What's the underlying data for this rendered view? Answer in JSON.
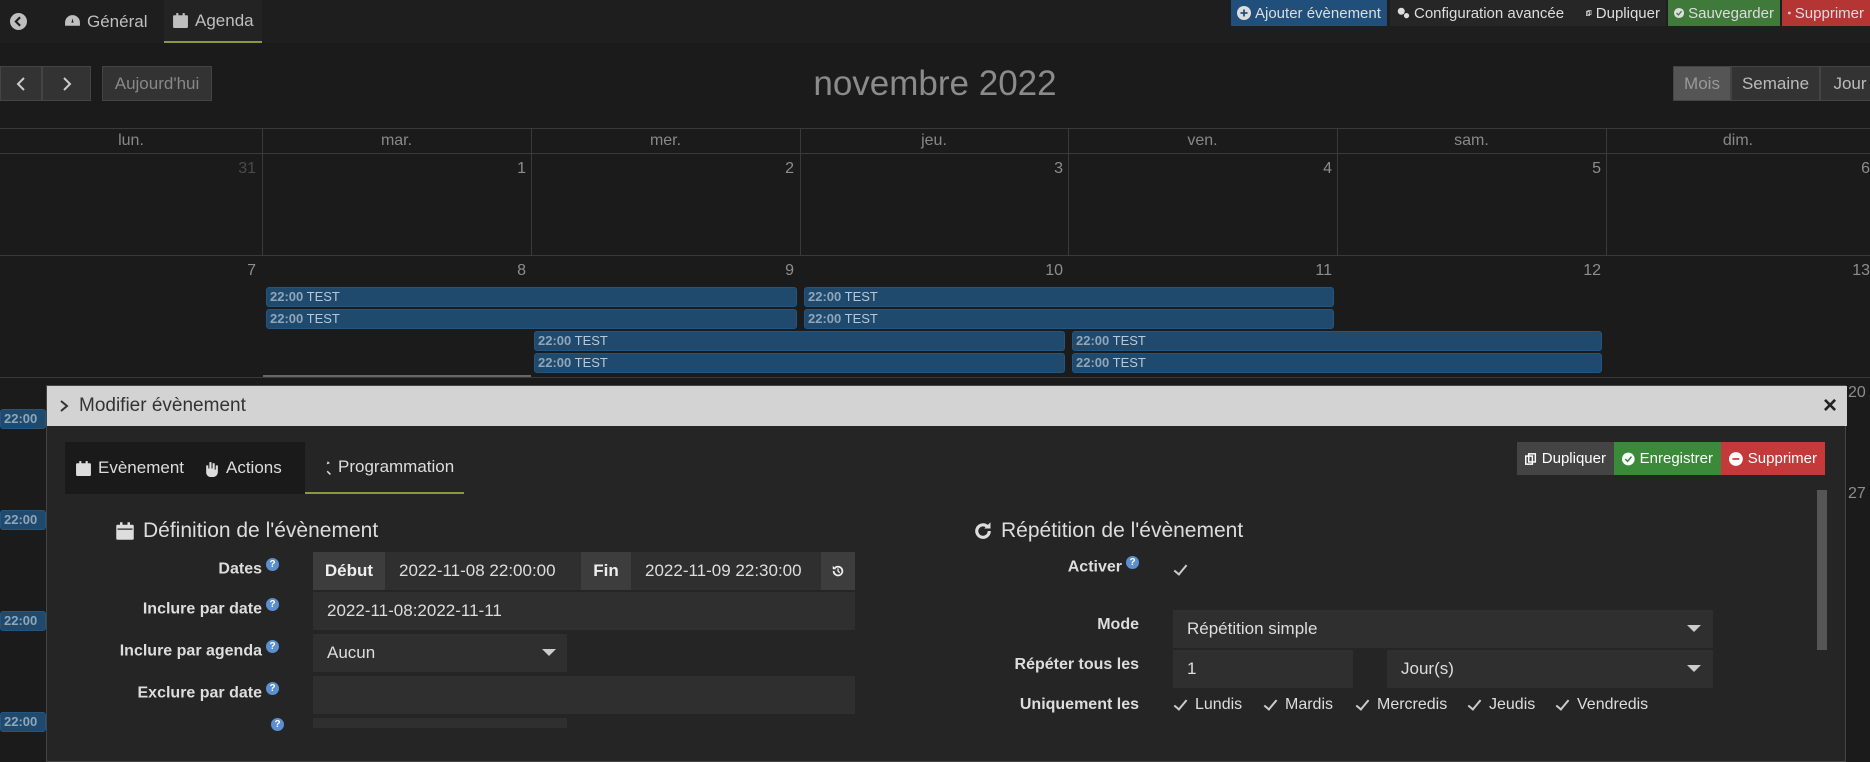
{
  "topbar": {
    "back_icon": "arrow-left-circle-icon",
    "tabs": [
      {
        "label": "Général",
        "icon": "gauge-icon"
      },
      {
        "label": "Agenda",
        "icon": "calendar-icon"
      }
    ],
    "actions": [
      {
        "label": "Ajouter évènement",
        "icon": "plus-circle-icon",
        "color": "#1f4f7a"
      },
      {
        "label": "Configuration avancée",
        "icon": "cogs-icon",
        "color": "#262626"
      },
      {
        "label": "Dupliquer",
        "icon": "copy-icon",
        "color": "#262626"
      },
      {
        "label": "Sauvegarder",
        "icon": "check-circle-icon",
        "color": "#3f7a3a"
      },
      {
        "label": "Supprimer",
        "icon": "minus-circle-icon",
        "color": "#b53434"
      }
    ]
  },
  "calendar": {
    "title": "novembre 2022",
    "today_label": "Aujourd'hui",
    "prev_icon": "chevron-left-icon",
    "next_icon": "chevron-right-icon",
    "views": [
      "Mois",
      "Semaine",
      "Jour"
    ],
    "active_view": "Mois",
    "weekdays": [
      "lun.",
      "mar.",
      "mer.",
      "jeu.",
      "ven.",
      "sam.",
      "dim."
    ],
    "week1": [
      "31",
      "1",
      "2",
      "3",
      "4",
      "5",
      "6"
    ],
    "week2": [
      "7",
      "8",
      "9",
      "10",
      "11",
      "12",
      "13"
    ],
    "week3_partial": [
      "20",
      "27"
    ],
    "event_time": "22:00",
    "event_title": "TEST"
  },
  "modal": {
    "title": "Modifier évènement",
    "tabs": [
      {
        "label": "Evènement",
        "icon": "calendar-icon"
      },
      {
        "label": "Actions",
        "icon": "hand-icon"
      },
      {
        "label": "Programmation",
        "icon": "tools-icon"
      }
    ],
    "active_tab": "Programmation",
    "buttons": {
      "duplicate": "Dupliquer",
      "save": "Enregistrer",
      "delete": "Supprimer"
    },
    "definition": {
      "title": "Définition de l'évènement",
      "dates_label": "Dates",
      "start_addon": "Début",
      "start_value": "2022-11-08 22:00:00",
      "end_addon": "Fin",
      "end_value": "2022-11-09 22:30:00",
      "include_date_label": "Inclure par date",
      "include_date_value": "2022-11-08:2022-11-11",
      "include_agenda_label": "Inclure par agenda",
      "include_agenda_value": "Aucun",
      "exclude_date_label": "Exclure par date",
      "exclude_date_value": ""
    },
    "repeat": {
      "title": "Répétition de l'évènement",
      "enable_label": "Activer",
      "mode_label": "Mode",
      "mode_value": "Répétition simple",
      "every_label": "Répéter tous les",
      "every_value": "1",
      "unit_value": "Jour(s)",
      "only_label": "Uniquement les",
      "days": [
        "Lundis",
        "Mardis",
        "Mercredis",
        "Jeudis",
        "Vendredis"
      ]
    }
  }
}
